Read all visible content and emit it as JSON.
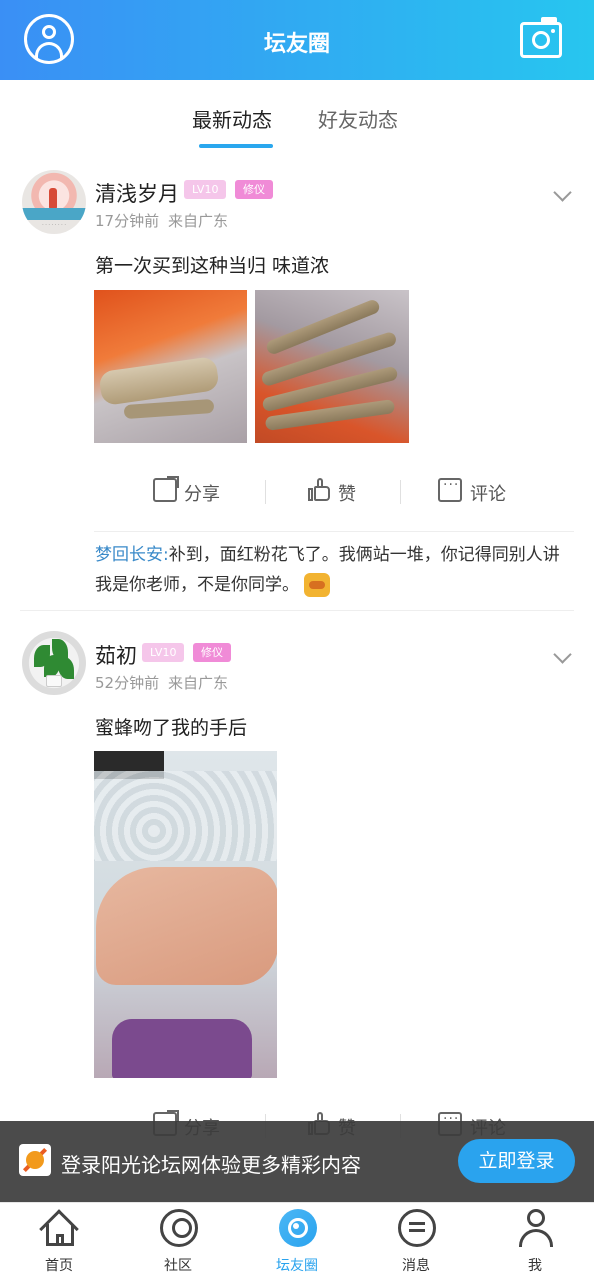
{
  "header": {
    "title": "坛友圈"
  },
  "tabs": [
    {
      "label": "最新动态"
    },
    {
      "label": "好友动态"
    }
  ],
  "posts": [
    {
      "author": "清浅岁月",
      "level": "LV10",
      "role": "修仪",
      "time": "17分钟前",
      "location": "来自广东",
      "text": "第一次买到这种当归 味道浓",
      "actions": {
        "share": "分享",
        "like": "赞",
        "comment": "评论"
      },
      "comments": [
        {
          "user": "梦回长安:",
          "text": "补到，面红粉花飞了。我俩站一堆，你记得同别人讲我是你老师，不是你同学。"
        }
      ]
    },
    {
      "author": "茹初",
      "level": "LV10",
      "role": "修仪",
      "time": "52分钟前",
      "location": "来自广东",
      "text": "蜜蜂吻了我的手后",
      "actions": {
        "share": "分享",
        "like": "赞",
        "comment": "评论"
      }
    }
  ],
  "banner": {
    "text": "登录阳光论坛网体验更多精彩内容",
    "button": "立即登录"
  },
  "bottom_nav": [
    {
      "label": "首页"
    },
    {
      "label": "社区"
    },
    {
      "label": "坛友圈"
    },
    {
      "label": "消息"
    },
    {
      "label": "我"
    }
  ],
  "colors": {
    "accent": "#2aa3ee",
    "header_start": "#3a8ff5",
    "header_end": "#27c6ef"
  }
}
